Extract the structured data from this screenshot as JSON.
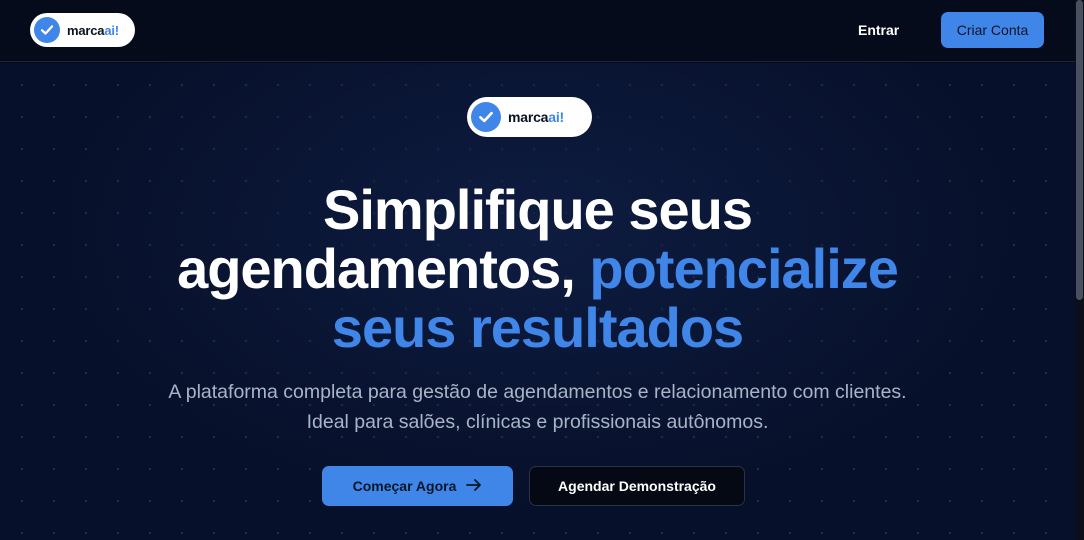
{
  "header": {
    "logo": {
      "text_main": "marca",
      "text_accent": "ai!"
    },
    "login_label": "Entrar",
    "signup_label": "Criar Conta"
  },
  "hero": {
    "logo": {
      "text_main": "marca",
      "text_accent": "ai!"
    },
    "headline_line1": "Simplifique seus",
    "headline_line2_white": "agendamentos,",
    "headline_line2_accent": "potencialize",
    "headline_line3_accent": "seus resultados",
    "subtitle_line1": "A plataforma completa para gestão de agendamentos e relacionamento com clientes.",
    "subtitle_line2": "Ideal para salões, clínicas e profissionais autônomos.",
    "cta_primary_label": "Começar Agora",
    "cta_secondary_label": "Agendar Demonstração"
  },
  "icons": {
    "logo_check": "check-icon",
    "cta_arrow": "arrow-right-icon"
  },
  "colors": {
    "accent": "#3f86e8",
    "background": "#050b1a",
    "text_primary": "#ffffff",
    "text_muted": "#a9b4c7"
  }
}
